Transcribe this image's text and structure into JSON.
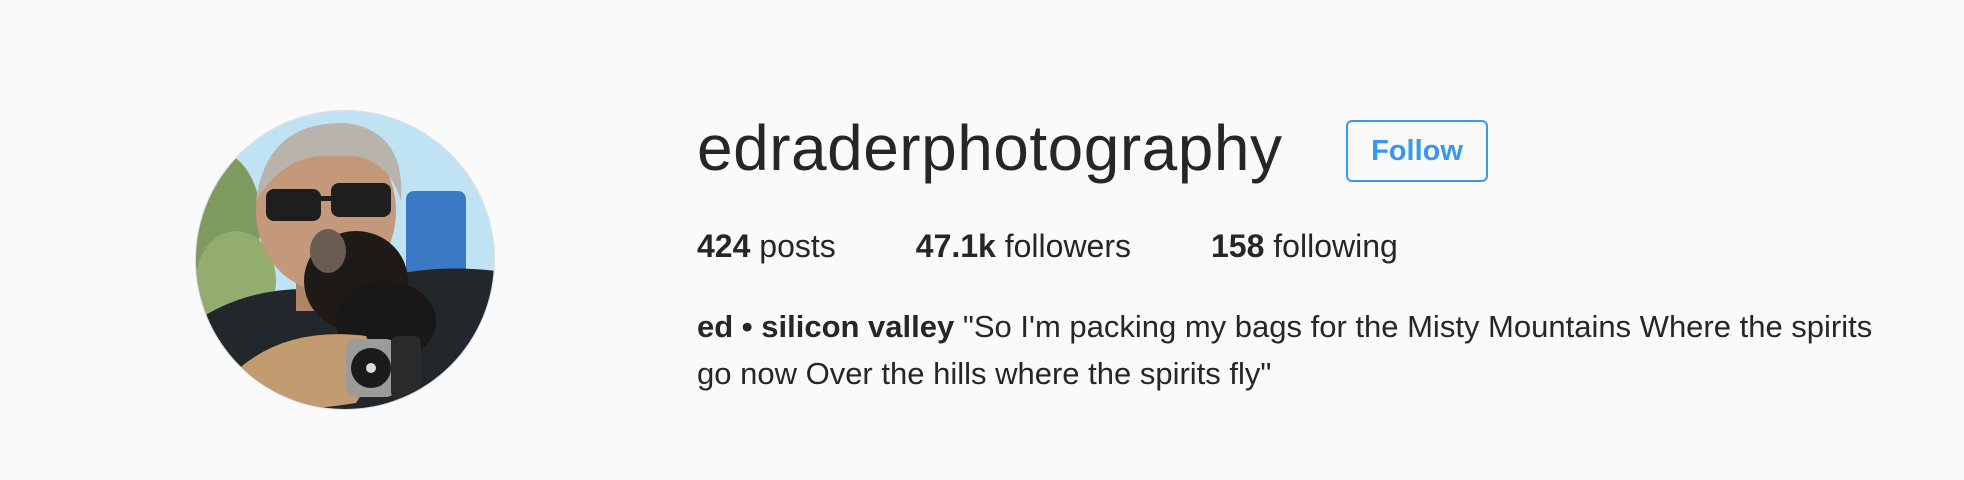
{
  "profile": {
    "username": "edraderphotography",
    "follow_label": "Follow",
    "stats": [
      {
        "count": "424",
        "label": "posts"
      },
      {
        "count": "47.1k",
        "label": "followers"
      },
      {
        "count": "158",
        "label": "following"
      }
    ],
    "bio": {
      "full_name": "ed • silicon valley",
      "text": "\"So I'm packing my bags for the Misty Mountains Where the spirits go now Over the hills where the spirits fly\""
    }
  },
  "colors": {
    "background": "#fafafa",
    "text": "#262626",
    "accent": "#3897f0",
    "avatar_border": "#dbdbdb"
  }
}
